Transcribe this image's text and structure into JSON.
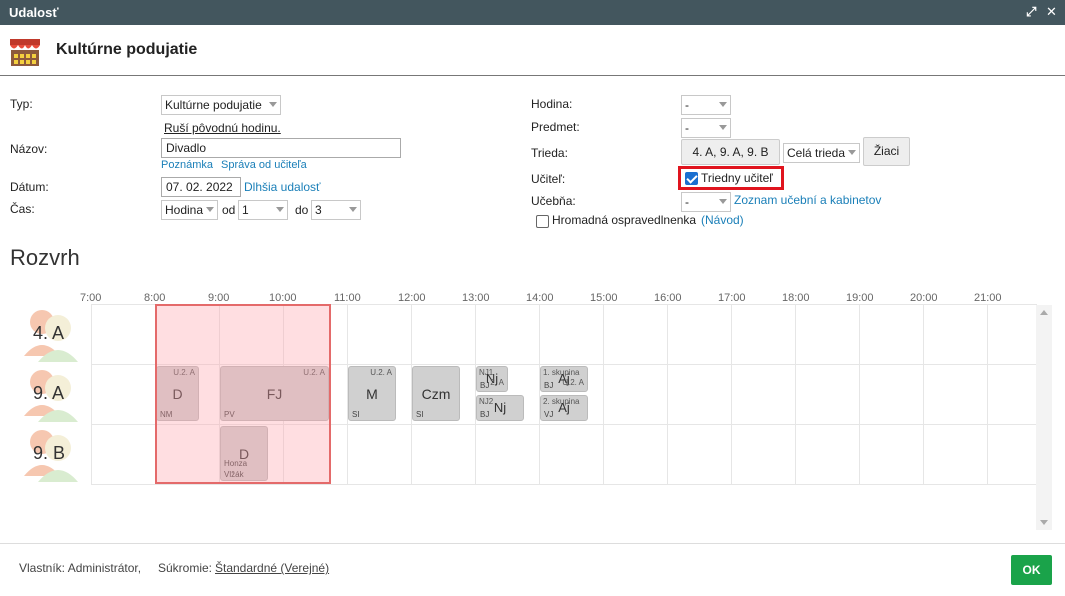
{
  "window": {
    "title": "Udalosť",
    "expand_glyph": "⤢",
    "close_glyph": "✕",
    "icons": [
      "expand-icon",
      "close-icon",
      "theater-icon"
    ]
  },
  "header": {
    "title": "Kultúrne podujatie"
  },
  "form": {
    "typ_label": "Typ:",
    "typ_value": "Kultúrne podujatie",
    "rusi_link": "Ruší pôvodnú hodinu.",
    "nazov_label": "Názov:",
    "nazov_value": "Divadlo",
    "poznamka_link": "Poznámka",
    "sprava_link": "Správa od učiteľa",
    "datum_label": "Dátum:",
    "datum_value": "07. 02. 2022",
    "dlhsia_link": "Dlhšia udalosť",
    "cas_label": "Čas:",
    "cas_mode": "Hodina",
    "od_label": "od",
    "od_value": "1",
    "do_label": "do",
    "do_value": "3",
    "hodina_label": "Hodina:",
    "hodina_value": "-",
    "predmet_label": "Predmet:",
    "predmet_value": "-",
    "trieda_label": "Trieda:",
    "trieda_value": "4. A, 9. A, 9. B",
    "cela_trieda": "Celá trieda",
    "ziaci_button": "Žiaci",
    "ucitel_label": "Učiteľ:",
    "triedny_ucitel": "Triedny učiteľ",
    "ucebna_label": "Učebňa:",
    "ucebna_value": "-",
    "zoznam_link": "Zoznam učební a kabinetov",
    "hromadna_label": "Hromadná ospravedlnenka",
    "navod_link": "(Návod)"
  },
  "schedule": {
    "title": "Rozvrh",
    "hours": [
      "7:00",
      "8:00",
      "9:00",
      "10:00",
      "11:00",
      "12:00",
      "13:00",
      "14:00",
      "15:00",
      "16:00",
      "17:00",
      "18:00",
      "19:00",
      "20:00",
      "21:00"
    ],
    "rows": [
      "4. A",
      "9. A",
      "9. B"
    ],
    "lessons": {
      "a_d": {
        "room": "U.2. A",
        "subj": "D",
        "teacher": "NM"
      },
      "a_fj": {
        "room": "U.2. A",
        "subj": "FJ",
        "teacher": "PV"
      },
      "a_m": {
        "room": "U.2. A",
        "subj": "M",
        "teacher": "SI"
      },
      "a_czm": {
        "room": "",
        "subj": "Czm",
        "teacher": "SI"
      },
      "a_nj1": {
        "room": "NJ1",
        "subj": "Nj",
        "teacher": "BJ",
        "extra": "2. A"
      },
      "a_nj2": {
        "room": "NJ2",
        "subj": "Nj",
        "teacher": "BJ"
      },
      "a_aj1": {
        "room": "1. skupina",
        "subj": "Aj",
        "teacher": "BJ",
        "extra": "U.2. A"
      },
      "a_aj2": {
        "room": "2. skupina",
        "subj": "Aj",
        "teacher": "VJ"
      },
      "b_d": {
        "subj": "D",
        "teacher1": "Honza",
        "teacher2": "Vlžák"
      }
    }
  },
  "footer": {
    "owner": "Vlastník: Administrátor,",
    "privacy_label": "Súkromie:",
    "privacy_value": "Štandardné (Verejné)",
    "ok": "OK"
  },
  "colors": {
    "titlebar": "#43565e",
    "link": "#1a7fb8",
    "ok": "#1aa34a",
    "highlight": "#e0141e"
  }
}
